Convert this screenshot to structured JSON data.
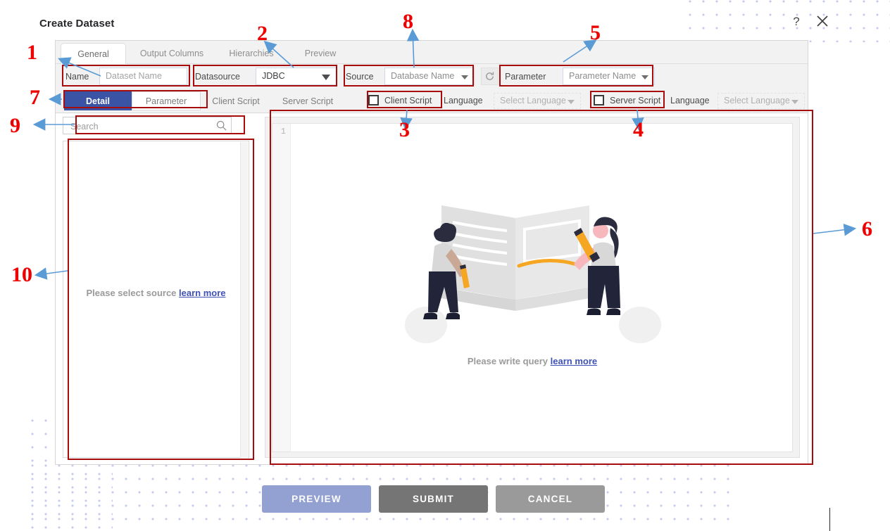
{
  "dialog": {
    "title": "Create Dataset",
    "help_icon": "?",
    "close_icon": "x"
  },
  "top_tabs": [
    {
      "label": "General",
      "active": true
    },
    {
      "label": "Output Columns",
      "active": false
    },
    {
      "label": "Hierarchies",
      "active": false
    },
    {
      "label": "Preview",
      "active": false
    }
  ],
  "fields": {
    "name_label": "Name",
    "name_placeholder": "Dataset Name",
    "datasource_label": "Datasource",
    "datasource_value": "JDBC",
    "source_label": "Source",
    "source_placeholder": "Database Name",
    "refresh_icon": "refresh-icon",
    "parameter_label": "Parameter",
    "parameter_placeholder": "Parameter Name"
  },
  "sub_tabs": [
    {
      "label": "Detail",
      "active": true
    },
    {
      "label": "Parameter",
      "active": false
    },
    {
      "label": "Client Script",
      "active": false
    },
    {
      "label": "Server Script",
      "active": false
    }
  ],
  "script_toggles": {
    "client_script_label": "Client Script",
    "client_script_checked": false,
    "client_language_label": "Language",
    "client_language_value": "Select Language",
    "server_script_label": "Server Script",
    "server_script_checked": false,
    "server_language_label": "Language",
    "server_language_value": "Select Language"
  },
  "left_panel": {
    "search_placeholder": "Search",
    "search_value": "",
    "search_icon": "search-icon",
    "empty_text": "Please select source ",
    "empty_link": "learn more"
  },
  "right_panel": {
    "gutter_line_number": "1",
    "empty_text": "Please write query ",
    "empty_link": "learn more",
    "illustration": "two-people-writing-in-book-illustration"
  },
  "footer": {
    "preview_label": "PREVIEW",
    "submit_label": "SUBMIT",
    "cancel_label": "CANCEL"
  },
  "colors": {
    "accent_blue": "#3a53a4",
    "annotation_red": "#a70b0b",
    "annotation_number": "#ee0000",
    "preview_button": "#93a0d2",
    "submit_button": "#757575",
    "cancel_button": "#9a9a9a",
    "link_blue": "#3f51b5",
    "dot_pattern": "#b9c2ec"
  },
  "annotations": [
    {
      "id": "1",
      "num": "1"
    },
    {
      "id": "2",
      "num": "2"
    },
    {
      "id": "3",
      "num": "3"
    },
    {
      "id": "4",
      "num": "4"
    },
    {
      "id": "5",
      "num": "5"
    },
    {
      "id": "6",
      "num": "6"
    },
    {
      "id": "7",
      "num": "7"
    },
    {
      "id": "8",
      "num": "8"
    },
    {
      "id": "9",
      "num": "9"
    },
    {
      "id": "10",
      "num": "10"
    }
  ]
}
